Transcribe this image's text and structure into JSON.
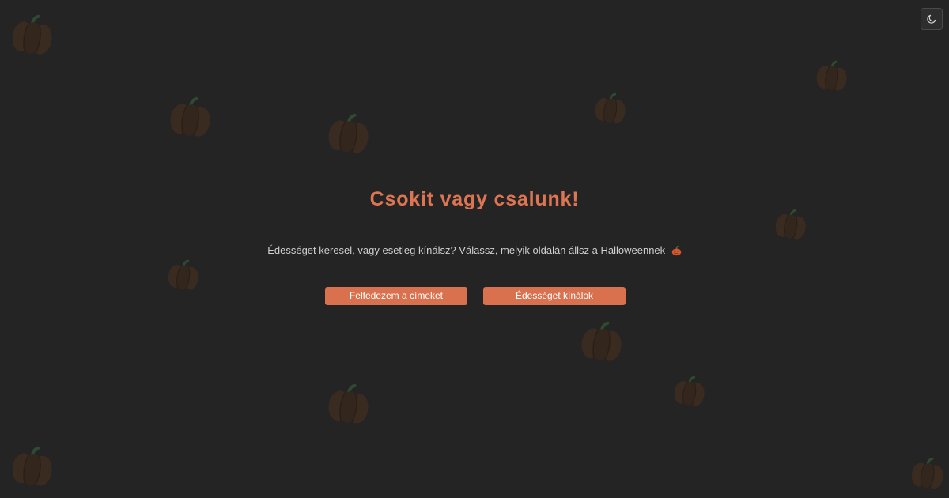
{
  "header": {
    "theme_toggle_icon": "moon-icon"
  },
  "hero": {
    "title": "Csokit vagy csalunk!",
    "subtitle": "Édességet keresel, vagy esetleg kínálsz? Válassz, melyik oldalán állsz a Halloweennek",
    "subtitle_icon": "pumpkin-emoji-icon"
  },
  "actions": {
    "explore_label": "Felfedezem a címeket",
    "give_label": "Édességet kínálok"
  },
  "theme": {
    "background": "#242424",
    "accent": "#dd7552",
    "pumpkin_body": "#3a2b21",
    "pumpkin_stem": "#2e4a33"
  },
  "background": {
    "decoration_icon": "pumpkin-icon"
  }
}
